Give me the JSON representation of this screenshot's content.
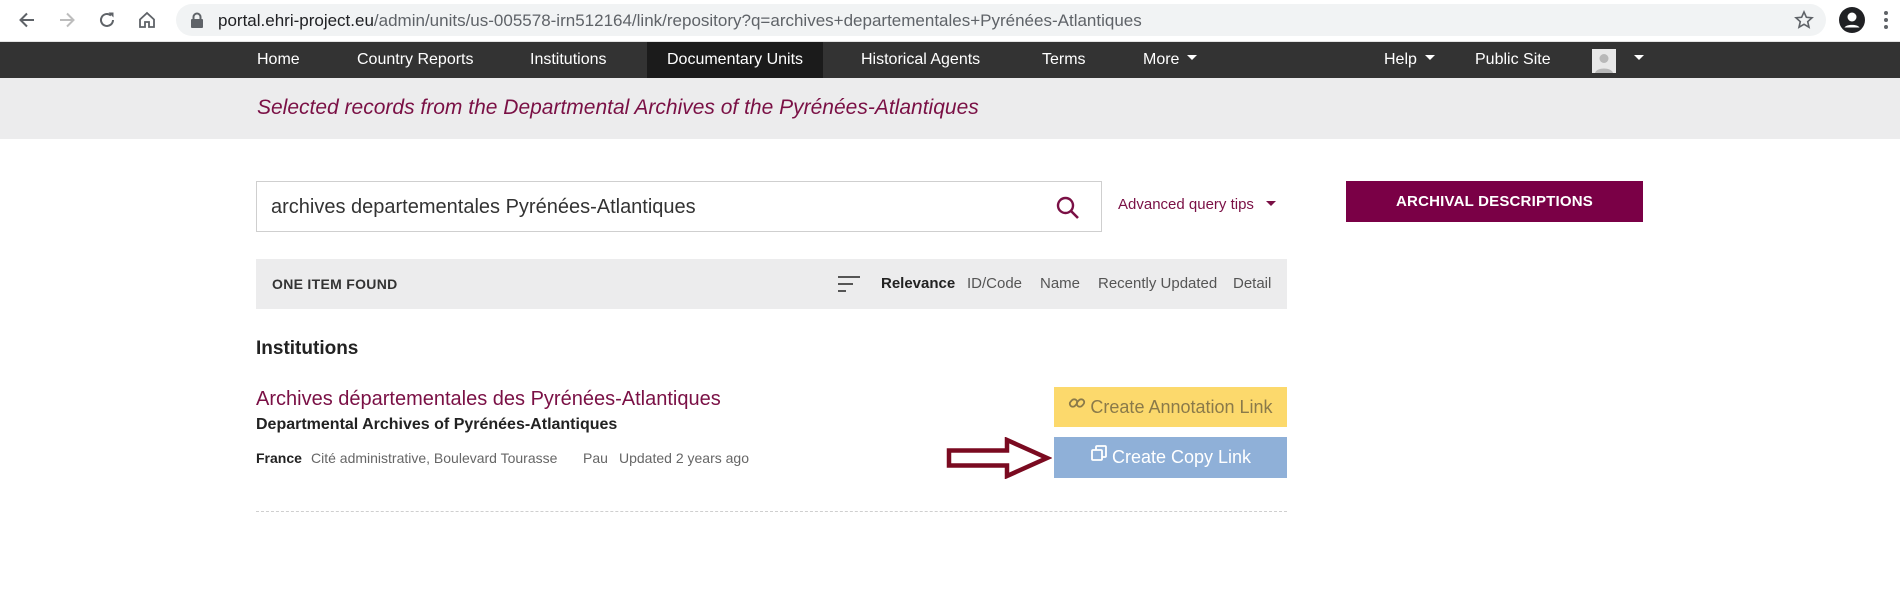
{
  "browser": {
    "url_host": "portal.ehri-project.eu",
    "url_path": "/admin/units/us-005578-irn512164/link/repository?q=archives+departementales+Pyrénées-Atlantiques"
  },
  "navbar": {
    "items": [
      "Home",
      "Country Reports",
      "Institutions",
      "Documentary Units",
      "Historical Agents",
      "Terms",
      "More"
    ],
    "help": "Help",
    "public_site": "Public Site"
  },
  "banner": {
    "title": "Selected records from the Departmental Archives of the Pyrénées-Atlantiques"
  },
  "search": {
    "value": "archives departementales Pyrénées-Atlantiques",
    "advanced_tips": "Advanced query tips"
  },
  "archival_descriptions": "ARCHIVAL DESCRIPTIONS",
  "results": {
    "count_label": "ONE ITEM FOUND",
    "sort_options": [
      "Relevance",
      "ID/Code",
      "Name",
      "Recently Updated",
      "Detail"
    ],
    "section_title": "Institutions",
    "record": {
      "title": "Archives départementales des Pyrénées-Atlantiques",
      "subtitle": "Departmental Archives of Pyrénées-Atlantiques",
      "country": "France",
      "address": "Cité administrative, Boulevard Tourasse",
      "city": "Pau",
      "updated": "Updated 2 years ago"
    }
  },
  "buttons": {
    "annotation": "Create Annotation Link",
    "copy": "Create Copy Link"
  },
  "colors": {
    "accent": "#7a1045",
    "annotation_button": "#fcd96c",
    "copy_button": "#8fb0d8",
    "arrow": "#7a0a20"
  },
  "icons": [
    "back-icon",
    "forward-icon",
    "reload-icon",
    "home-icon",
    "lock-icon",
    "star-icon",
    "profile-icon",
    "menu-icon",
    "search-icon",
    "sort-icon",
    "link-icon",
    "copy-icon"
  ]
}
